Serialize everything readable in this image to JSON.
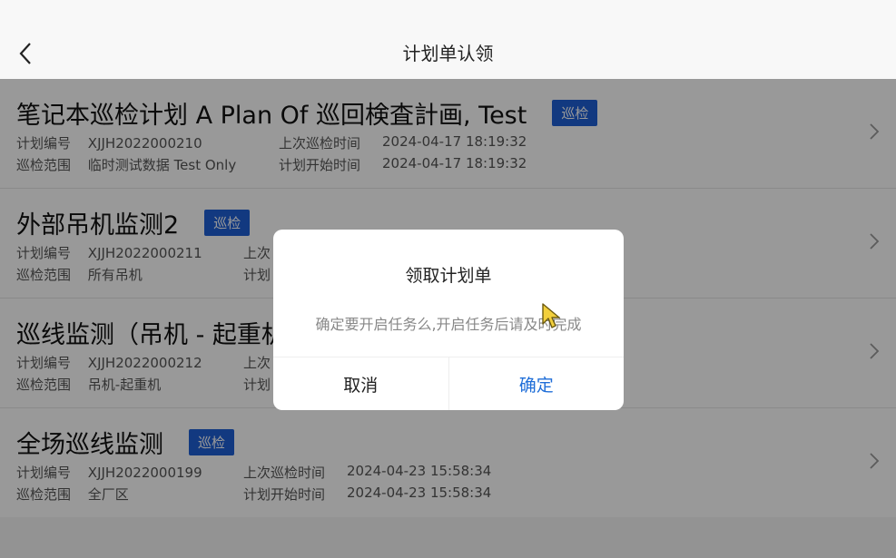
{
  "header": {
    "title": "计划单认领"
  },
  "items": [
    {
      "title": "笔记本巡检计划 A Plan Of 巡回検査計画, Test",
      "tag": "巡检",
      "plan_no_label": "计划编号",
      "plan_no": "XJJH2022000210",
      "scope_label": "巡检范围",
      "scope": "临时测试数据 Test Only",
      "last_label": "上次巡检时间",
      "last_time": "2024-04-17 18:19:32",
      "start_label": "计划开始时间",
      "start_time": "2024-04-17 18:19:32"
    },
    {
      "title": "外部吊机监测2",
      "tag": "巡检",
      "plan_no_label": "计划编号",
      "plan_no": "XJJH2022000211",
      "scope_label": "巡检范围",
      "scope": "所有吊机",
      "last_label": "上次",
      "last_time": "",
      "start_label": "计划",
      "start_time": ""
    },
    {
      "title": "巡线监测（吊机 - 起重机",
      "tag": "",
      "plan_no_label": "计划编号",
      "plan_no": "XJJH2022000212",
      "scope_label": "巡检范围",
      "scope": "吊机-起重机",
      "last_label": "上次",
      "last_time": "",
      "start_label": "计划",
      "start_time": ""
    },
    {
      "title": "全场巡线监测",
      "tag": "巡检",
      "plan_no_label": "计划编号",
      "plan_no": "XJJH2022000199",
      "scope_label": "巡检范围",
      "scope": "全厂区",
      "last_label": "上次巡检时间",
      "last_time": "2024-04-23 15:58:34",
      "start_label": "计划开始时间",
      "start_time": "2024-04-23 15:58:34"
    }
  ],
  "dialog": {
    "title": "领取计划单",
    "message": "确定要开启任务么,开启任务后请及时完成",
    "cancel_label": "取消",
    "ok_label": "确定"
  },
  "colors": {
    "accent": "#1f6ed8",
    "tag_bg": "#1f5fd6",
    "overlay": "rgba(0,0,0,0.4)"
  },
  "icons": {
    "back": "chevron-left-icon",
    "row": "chevron-right-icon",
    "cursor": "mouse-pointer-icon"
  }
}
